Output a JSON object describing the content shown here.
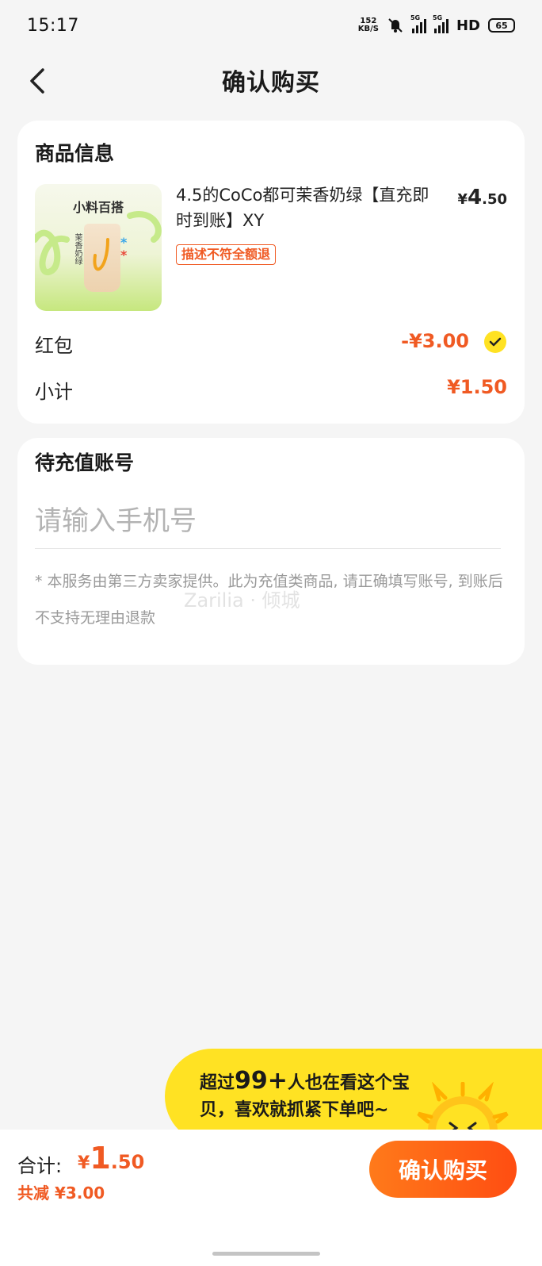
{
  "status_bar": {
    "time": "15:17",
    "net_speed_top": "152",
    "net_speed_bottom": "KB/S",
    "sig1_label": "5G",
    "sig2_label": "5G",
    "hd": "HD",
    "battery": "65"
  },
  "header": {
    "title": "确认购买"
  },
  "product_card": {
    "section_title": "商品信息",
    "thumb_title": "小料百搭",
    "thumb_side_text": "茉香奶绿",
    "name": "4.5的CoCo都可茉香奶绿【直充即时到账】XY",
    "price_symbol": "¥",
    "price_int": "4",
    "price_dec": ".50",
    "badge": "描述不符全额退",
    "red_packet_label": "红包",
    "red_packet_value": "-¥3.00",
    "subtotal_label": "小计",
    "subtotal_value": "¥1.50"
  },
  "account_card": {
    "section_title": "待充值账号",
    "phone_placeholder": "请输入手机号",
    "phone_value": "",
    "notice": "* 本服务由第三方卖家提供。此为充值类商品, 请正确填写账号, 到账后不支持无理由退款",
    "watermark": "Zarilia · 倾城"
  },
  "promo": {
    "prefix": "超过",
    "count": "99+",
    "line1_suffix": "人也在看这个宝",
    "line2": "贝，喜欢就抓紧下单吧~"
  },
  "bottom_bar": {
    "total_label": "合计:",
    "total_symbol": "¥",
    "total_int": "1",
    "total_dec": ".50",
    "saved": "共减 ¥3.00",
    "confirm_label": "确认购买"
  },
  "colors": {
    "accent": "#f05a23",
    "check": "#ffe223",
    "promo_bg": "#ffe223"
  }
}
